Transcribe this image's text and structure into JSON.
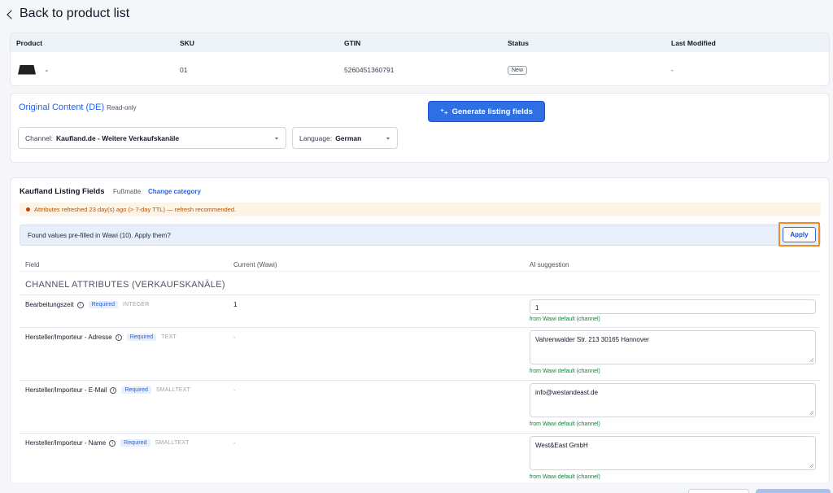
{
  "nav": {
    "back_label": "Back to product list"
  },
  "product_table": {
    "headers": [
      "Product",
      "SKU",
      "GTIN",
      "Status",
      "Last Modified"
    ],
    "row": {
      "name": "-",
      "sku": "01",
      "gtin": "5260451360791",
      "status": "New",
      "last_modified": "-"
    }
  },
  "original_content": {
    "title": "Original Content (DE)",
    "readonly_label": "Read-only",
    "generate_button": "Generate listing fields",
    "channel_label": "Channel:",
    "channel_value": "Kaufland.de - Weitere Verkaufskanäle",
    "language_label": "Language:",
    "language_value": "German"
  },
  "listing_fields": {
    "title": "Kaufland Listing Fields",
    "category": "Fußmatte",
    "change_category": "Change category",
    "warning": "Attributes refreshed 23 day(s) ago (> 7-day TTL) — refresh recommended.",
    "found_message": "Found values pre-filled in Wawi (10). Apply them?",
    "apply_button": "Apply",
    "columns": {
      "field": "Field",
      "current": "Current (Wawi)",
      "ai": "AI suggestion"
    },
    "section_title": "CHANNEL ATTRIBUTES (VERKAUFSKANÄLE)",
    "rows": [
      {
        "name": "Bearbeitungszeit",
        "required": "Required",
        "type": "INTEGER",
        "current": "1",
        "ai": "1",
        "source": "from Wawi default (channel)"
      },
      {
        "name": "Hersteller/Importeur - Adresse",
        "required": "Required",
        "type": "TEXT",
        "current": "-",
        "ai": "Vahrenwalder Str. 213 30165 Hannover",
        "source": "from Wawi default (channel)"
      },
      {
        "name": "Hersteller/Importeur - E-Mail",
        "required": "Required",
        "type": "SMALLTEXT",
        "current": "-",
        "ai": "info@westandeast.de",
        "source": "from Wawi default (channel)"
      },
      {
        "name": "Hersteller/Importeur - Name",
        "required": "Required",
        "type": "SMALLTEXT",
        "current": "-",
        "ai": "West&East GmbH",
        "source": "from Wawi default (channel)"
      }
    ]
  },
  "colors": {
    "primary": "#2f6fe4",
    "highlight": "#f08a24",
    "success": "#15803d",
    "warning": "#b45309"
  }
}
